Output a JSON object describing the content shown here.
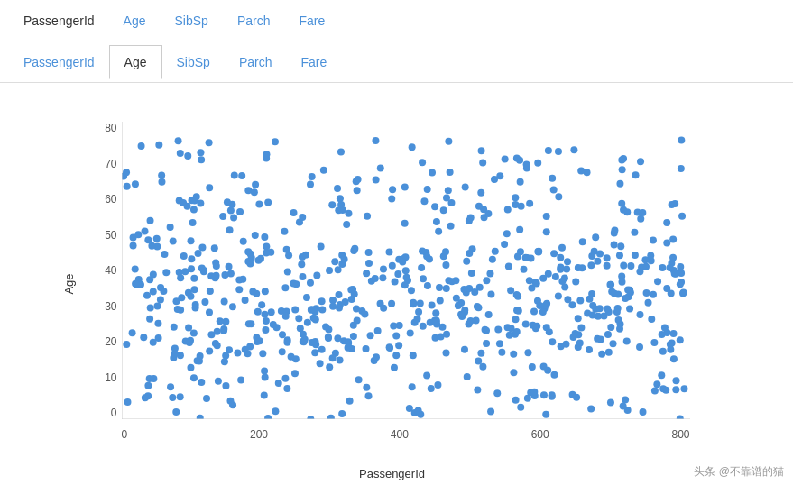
{
  "topTabs": {
    "items": [
      {
        "label": "PassengerId",
        "active": false
      },
      {
        "label": "Age",
        "active": false
      },
      {
        "label": "SibSp",
        "active": false
      },
      {
        "label": "Parch",
        "active": false
      },
      {
        "label": "Fare",
        "active": false
      }
    ]
  },
  "secondTabs": {
    "items": [
      {
        "label": "PassengerId",
        "active": false
      },
      {
        "label": "Age",
        "active": true
      },
      {
        "label": "SibSp",
        "active": false
      },
      {
        "label": "Parch",
        "active": false
      },
      {
        "label": "Fare",
        "active": false
      }
    ]
  },
  "chart": {
    "xLabel": "PassengerId",
    "yLabel": "Age",
    "xTicks": [
      "0",
      "200",
      "400",
      "600",
      "800"
    ],
    "yTicks": [
      "0",
      "10",
      "20",
      "30",
      "40",
      "50",
      "60",
      "70",
      "80"
    ],
    "dotColor": "#4a90d9",
    "xMax": 900,
    "yMax": 85
  },
  "watermark": "头条 @不靠谱的猫"
}
